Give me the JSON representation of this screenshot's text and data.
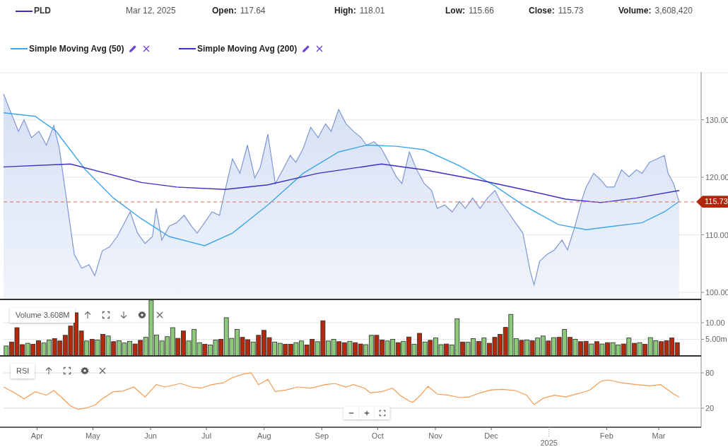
{
  "header": {
    "date": "Mar 12, 2025",
    "fields": [
      {
        "label": "Open:",
        "value": "117.64"
      },
      {
        "label": "High:",
        "value": "118.01"
      },
      {
        "label": "Low:",
        "value": "115.66"
      },
      {
        "label": "Close:",
        "value": "115.73"
      },
      {
        "label": "Volume:",
        "value": "3,608,420"
      }
    ]
  },
  "price_panel": {
    "chart_data": {
      "type": "line",
      "grid": true,
      "xlim": [
        "2024-03-14",
        "2025-03-23"
      ],
      "ylim": [
        98.65,
        138.3
      ],
      "yticks": [
        {
          "value": 100,
          "label": "100.00"
        },
        {
          "value": 110,
          "label": "110.00"
        },
        {
          "value": 120,
          "label": "120.00"
        },
        {
          "value": 130,
          "label": "130.00"
        }
      ],
      "series": [
        {
          "name": "PLD",
          "type": "area",
          "color": "#7f97d4",
          "x": [
            "2024-03-14",
            "2024-03-18",
            "2024-03-22",
            "2024-03-25",
            "2024-03-29",
            "2024-04-02",
            "2024-04-06",
            "2024-04-10",
            "2024-04-13",
            "2024-04-17",
            "2024-04-21",
            "2024-04-25",
            "2024-04-29",
            "2024-05-02",
            "2024-05-06",
            "2024-05-10",
            "2024-05-14",
            "2024-05-17",
            "2024-05-21",
            "2024-05-25",
            "2024-05-29",
            "2024-06-02",
            "2024-06-04",
            "2024-06-07",
            "2024-06-11",
            "2024-06-15",
            "2024-06-19",
            "2024-06-23",
            "2024-06-26",
            "2024-06-30",
            "2024-07-04",
            "2024-07-08",
            "2024-07-11",
            "2024-07-15",
            "2024-07-19",
            "2024-07-23",
            "2024-07-27",
            "2024-07-30",
            "2024-08-03",
            "2024-08-07",
            "2024-08-11",
            "2024-08-15",
            "2024-08-18",
            "2024-08-22",
            "2024-08-26",
            "2024-08-30",
            "2024-09-03",
            "2024-09-06",
            "2024-09-10",
            "2024-09-14",
            "2024-09-18",
            "2024-09-22",
            "2024-09-25",
            "2024-09-29",
            "2024-10-03",
            "2024-10-07",
            "2024-10-11",
            "2024-10-14",
            "2024-10-18",
            "2024-10-22",
            "2024-10-26",
            "2024-10-30",
            "2024-11-02",
            "2024-11-06",
            "2024-11-10",
            "2024-11-14",
            "2024-11-17",
            "2024-11-21",
            "2024-11-25",
            "2024-11-29",
            "2024-12-03",
            "2024-12-06",
            "2024-12-10",
            "2024-12-14",
            "2024-12-18",
            "2024-12-22",
            "2024-12-24",
            "2024-12-27",
            "2024-12-31",
            "2025-01-04",
            "2025-01-08",
            "2025-01-11",
            "2025-01-15",
            "2025-01-19",
            "2025-01-21",
            "2025-01-25",
            "2025-01-29",
            "2025-02-01",
            "2025-02-05",
            "2025-02-09",
            "2025-02-13",
            "2025-02-17",
            "2025-02-20",
            "2025-02-24",
            "2025-02-28",
            "2025-03-04",
            "2025-03-06",
            "2025-03-09",
            "2025-03-12"
          ],
          "values": [
            134.5,
            131.2,
            128,
            130,
            126.9,
            128,
            125.6,
            129,
            125,
            115.8,
            106.6,
            104.2,
            104.8,
            102.9,
            107.2,
            107.9,
            109.7,
            111.5,
            114,
            110.3,
            108.5,
            109.7,
            114.6,
            109.1,
            111.5,
            112.1,
            113.4,
            111.5,
            110.3,
            112.1,
            114,
            113.4,
            117.7,
            123.2,
            120.7,
            125.6,
            119.9,
            121.8,
            127.5,
            118.9,
            121.3,
            123.8,
            122.6,
            125,
            128.7,
            126.9,
            129.3,
            128,
            131.8,
            129.3,
            128,
            126.9,
            125.6,
            126.2,
            125,
            122.6,
            120.1,
            118.9,
            124.4,
            121.3,
            118.9,
            117.7,
            114.6,
            115.2,
            114,
            115.8,
            114.6,
            116.4,
            114.6,
            116.4,
            117.7,
            115.8,
            114,
            112.1,
            110.3,
            103.6,
            101.3,
            105.4,
            106.6,
            107.4,
            109.1,
            107.4,
            111.5,
            116.4,
            118.3,
            120.7,
            119.5,
            118.3,
            118.3,
            121.3,
            120.1,
            121.3,
            120.7,
            122.6,
            123.2,
            123.8,
            120.7,
            118.9,
            115.7
          ]
        },
        {
          "name": "Simple Moving Avg (50)",
          "type": "line",
          "color": "#3ea6e6",
          "x": [
            "2024-03-14",
            "2024-03-31",
            "2024-04-11",
            "2024-04-27",
            "2024-05-12",
            "2024-05-27",
            "2024-06-11",
            "2024-06-30",
            "2024-07-15",
            "2024-08-03",
            "2024-08-22",
            "2024-09-10",
            "2024-09-25",
            "2024-10-11",
            "2024-10-26",
            "2024-11-14",
            "2024-12-03",
            "2024-12-18",
            "2025-01-06",
            "2025-01-21",
            "2025-02-05",
            "2025-02-20",
            "2025-03-04",
            "2025-03-12"
          ],
          "values": [
            131.2,
            130.6,
            128.1,
            121.3,
            116.4,
            112.8,
            109.7,
            108.1,
            110.3,
            115.2,
            120.7,
            124.4,
            125.6,
            125.4,
            124.8,
            122,
            118.5,
            115.2,
            111.8,
            110.9,
            111.5,
            112.1,
            114,
            115.8
          ]
        },
        {
          "name": "Simple Moving Avg (200)",
          "type": "line",
          "color": "#3b2fc4",
          "x": [
            "2024-03-14",
            "2024-04-19",
            "2024-05-08",
            "2024-05-27",
            "2024-06-15",
            "2024-07-11",
            "2024-08-03",
            "2024-08-30",
            "2024-10-03",
            "2024-10-26",
            "2024-11-25",
            "2024-12-18",
            "2025-01-10",
            "2025-01-29",
            "2025-02-17",
            "2025-03-12"
          ],
          "values": [
            121.8,
            122.3,
            120.7,
            119.1,
            118.3,
            117.9,
            118.7,
            120.7,
            122.3,
            121.3,
            119.5,
            117.9,
            116.2,
            115.6,
            116.4,
            117.7
          ]
        }
      ],
      "ref_lines": [
        {
          "axis": "y",
          "value": 115.73,
          "label": "115.73"
        }
      ]
    }
  },
  "volume_panel": {
    "label": "Volume 3.608M",
    "chart_data": {
      "type": "bar",
      "stacked": true,
      "grid": true,
      "ylim": [
        0,
        16.8
      ],
      "yticks": [
        {
          "value": 5,
          "label": "5.00m"
        },
        {
          "value": 10,
          "label": "10.00"
        }
      ],
      "series": [
        {
          "color": "#8cc97a",
          "values": [
            3.0,
            null,
            null,
            null,
            3.8,
            null,
            null,
            3.9,
            4.8,
            null,
            null,
            null,
            null,
            null,
            null,
            4.5,
            null,
            4.8,
            null,
            6.0,
            null,
            4.6,
            3.9,
            4.4,
            null,
            null,
            5.6,
            16.8,
            6.3,
            4.5,
            5.8,
            8.5,
            null,
            null,
            4.5,
            8.0,
            4.0,
            null,
            3.3,
            4.8,
            null,
            11.5,
            5.3,
            8.0,
            null,
            null,
            4.2,
            null,
            null,
            null,
            4.2,
            3.8,
            null,
            null,
            4.0,
            4.5,
            null,
            null,
            4.3,
            null,
            4.5,
            5.0,
            null,
            null,
            4.4,
            null,
            null,
            3.4,
            6.2,
            null,
            null,
            4.5,
            5.0,
            null,
            4.4,
            null,
            3.5,
            null,
            4.2,
            null,
            5.4,
            3.4,
            null,
            3.3,
            11.2,
            null,
            4.1,
            5.2,
            null,
            5.4,
            null,
            null,
            null,
            null,
            12.5,
            5.2,
            null,
            4.8,
            null,
            5.4,
            6.0,
            null,
            5.5,
            null,
            8.0,
            null,
            5.0,
            null,
            null,
            3.6,
            null,
            3.6,
            null,
            4.0,
            3.3,
            null,
            5.4,
            null,
            4.0,
            null,
            5.5,
            4.6,
            null,
            null,
            null,
            null
          ]
        },
        {
          "color": "#b22a0e",
          "values": [
            null,
            4.2,
            8.5,
            3.4,
            null,
            3.5,
            4.6,
            null,
            null,
            5.2,
            4.5,
            6.2,
            9.0,
            13.0,
            7.5,
            null,
            5.0,
            null,
            6.5,
            null,
            4.3,
            null,
            null,
            null,
            3.6,
            4.7,
            null,
            null,
            null,
            null,
            null,
            null,
            5.3,
            7.5,
            null,
            null,
            null,
            3.5,
            null,
            null,
            5.0,
            null,
            null,
            null,
            5.6,
            4.9,
            null,
            6.2,
            7.7,
            5.5,
            null,
            null,
            3.5,
            3.5,
            null,
            null,
            3.3,
            5.0,
            null,
            10.6,
            null,
            null,
            4.3,
            4.0,
            null,
            4.0,
            3.6,
            null,
            null,
            6.2,
            4.8,
            null,
            null,
            4.0,
            null,
            5.7,
            null,
            6.8,
            null,
            4.7,
            null,
            null,
            3.6,
            null,
            null,
            4.2,
            null,
            null,
            4.4,
            null,
            3.8,
            5.6,
            6.5,
            8.6,
            null,
            null,
            4.7,
            null,
            4.6,
            null,
            null,
            4.5,
            null,
            5.6,
            null,
            5.6,
            null,
            4.3,
            4.4,
            null,
            4.3,
            null,
            4.0,
            null,
            null,
            3.6,
            null,
            3.8,
            null,
            3.5,
            null,
            null,
            4.3,
            4.6,
            5.4,
            4.0
          ]
        }
      ]
    }
  },
  "rsi_panel": {
    "chart_data": {
      "type": "line",
      "grid": true,
      "xlim": [
        "2024-03-14",
        "2025-03-23"
      ],
      "ylim": [
        -12.4,
        107.6
      ],
      "yticks": [
        {
          "value": 20,
          "label": "20"
        },
        {
          "value": 80,
          "label": "80"
        }
      ],
      "xticks": [
        {
          "value": "2024-04-01",
          "label": "Apr"
        },
        {
          "value": "2024-05-01",
          "label": "May"
        },
        {
          "value": "2024-06-01",
          "label": "Jun"
        },
        {
          "value": "2024-07-01",
          "label": "Jul"
        },
        {
          "value": "2024-08-01",
          "label": "Aug"
        },
        {
          "value": "2024-09-01",
          "label": "Sep"
        },
        {
          "value": "2024-10-01",
          "label": "Oct"
        },
        {
          "value": "2024-11-01",
          "label": "Nov"
        },
        {
          "value": "2024-12-01",
          "label": "Dec"
        },
        {
          "value": "2025-02-01",
          "label": "Feb"
        },
        {
          "value": "2025-03-01",
          "label": "Mar"
        }
      ],
      "annotations": [
        {
          "text": "2025"
        }
      ],
      "series": [
        {
          "name": "RSI",
          "color": "#f59a4f",
          "x": [
            "2024-03-14",
            "2024-03-20",
            "2024-03-25",
            "2024-03-31",
            "2024-04-06",
            "2024-04-10",
            "2024-04-15",
            "2024-04-19",
            "2024-04-23",
            "2024-04-27",
            "2024-05-02",
            "2024-05-06",
            "2024-05-12",
            "2024-05-17",
            "2024-05-23",
            "2024-05-29",
            "2024-06-04",
            "2024-06-09",
            "2024-06-17",
            "2024-06-23",
            "2024-06-28",
            "2024-07-04",
            "2024-07-10",
            "2024-07-15",
            "2024-07-21",
            "2024-07-25",
            "2024-07-29",
            "2024-08-03",
            "2024-08-07",
            "2024-08-13",
            "2024-08-19",
            "2024-08-26",
            "2024-09-03",
            "2024-09-08",
            "2024-09-14",
            "2024-09-18",
            "2024-09-24",
            "2024-09-27",
            "2024-10-03",
            "2024-10-09",
            "2024-10-13",
            "2024-10-18",
            "2024-10-20",
            "2024-10-24",
            "2024-10-28",
            "2024-11-02",
            "2024-11-08",
            "2024-11-14",
            "2024-11-19",
            "2024-11-25",
            "2024-12-01",
            "2024-12-07",
            "2024-12-14",
            "2024-12-20",
            "2024-12-24",
            "2024-12-29",
            "2025-01-04",
            "2025-01-10",
            "2025-01-17",
            "2025-01-23",
            "2025-01-29",
            "2025-02-02",
            "2025-02-09",
            "2025-02-17",
            "2025-02-24",
            "2025-03-02",
            "2025-03-06",
            "2025-03-09",
            "2025-03-12"
          ],
          "values": [
            56,
            46,
            36,
            48,
            42,
            50,
            36,
            24,
            18,
            20,
            25,
            36,
            48,
            49,
            56,
            39,
            60,
            56,
            62,
            56,
            54,
            60,
            63,
            72,
            78,
            80,
            60,
            69,
            48,
            51,
            56,
            54,
            60,
            62,
            56,
            60,
            54,
            46,
            48,
            54,
            42,
            32,
            30,
            42,
            57,
            44,
            42,
            38,
            39,
            46,
            51,
            52,
            50,
            42,
            26,
            37,
            42,
            39,
            45,
            51,
            66,
            68,
            63,
            60,
            58,
            60,
            51,
            44,
            39
          ]
        }
      ]
    }
  }
}
